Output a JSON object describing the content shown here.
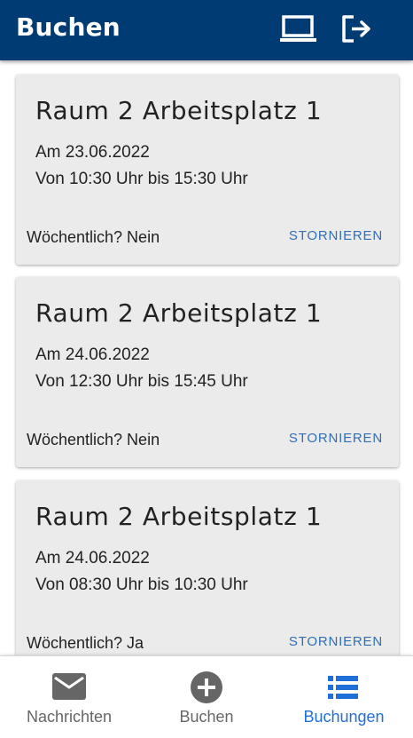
{
  "appbar": {
    "title": "Buchen",
    "desktop_icon": "desktop-icon",
    "logout_icon": "logout-icon",
    "background": "#003c73"
  },
  "bookings": [
    {
      "title": "Raum 2 Arbeitsplatz 1",
      "date": "Am 23.06.2022",
      "time": "Von 10:30 Uhr bis 15:30 Uhr",
      "weekly": "Wöchentlich? Nein",
      "cancel": "STORNIEREN"
    },
    {
      "title": "Raum 2 Arbeitsplatz 1",
      "date": "Am 24.06.2022",
      "time": "Von 12:30 Uhr bis 15:45 Uhr",
      "weekly": "Wöchentlich? Nein",
      "cancel": "STORNIEREN"
    },
    {
      "title": "Raum 2 Arbeitsplatz 1",
      "date": "Am 24.06.2022",
      "time": "Von 08:30 Uhr bis 10:30 Uhr",
      "weekly": "Wöchentlich? Ja",
      "cancel": "STORNIEREN"
    }
  ],
  "bottom_nav": {
    "items": [
      {
        "label": "Nachrichten",
        "icon": "mail-icon",
        "active": false
      },
      {
        "label": "Buchen",
        "icon": "add-circle-icon",
        "active": false
      },
      {
        "label": "Buchungen",
        "icon": "list-icon",
        "active": true
      }
    ],
    "active_color": "#1f6fd8",
    "inactive_color": "#666666"
  }
}
